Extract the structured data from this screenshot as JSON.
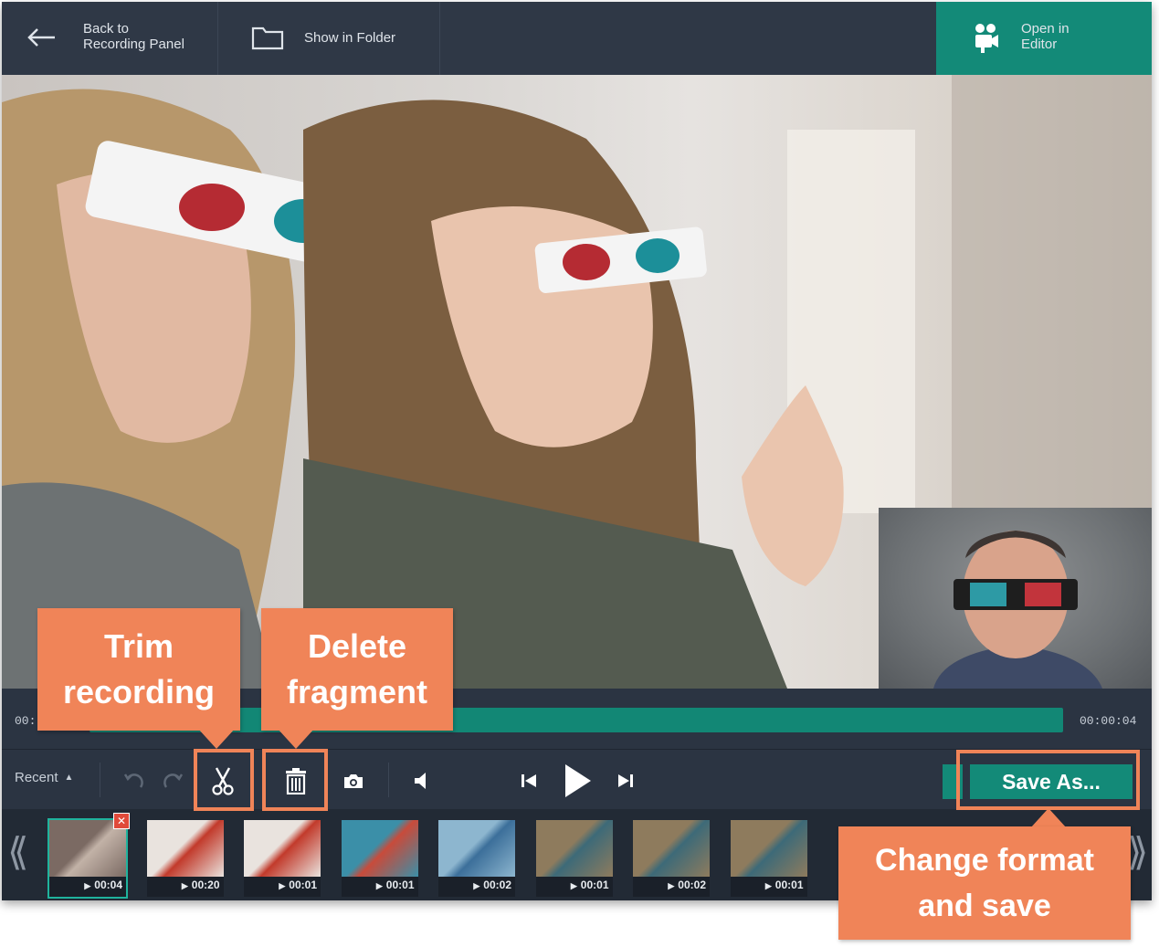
{
  "topbar": {
    "back_label": "Back to\nRecording Panel",
    "folder_label": "Show in Folder",
    "open_label": "Open in\nEditor"
  },
  "timeline": {
    "start_time": "00:",
    "end_time": "00:00:04"
  },
  "controls": {
    "recent_label": "Recent",
    "save_label": "Save As..."
  },
  "filmstrip": {
    "thumbnails": [
      {
        "duration": "00:04",
        "selected": true,
        "colors": [
          "#7b6a63",
          "#c2b2a7"
        ]
      },
      {
        "duration": "00:20",
        "colors": [
          "#e9e3de",
          "#c23a2b"
        ]
      },
      {
        "duration": "00:01",
        "colors": [
          "#e9e3de",
          "#c23a2b"
        ]
      },
      {
        "duration": "00:01",
        "colors": [
          "#3b8fa8",
          "#c84b3b"
        ]
      },
      {
        "duration": "00:02",
        "colors": [
          "#8db6cf",
          "#3c6f9a"
        ]
      },
      {
        "duration": "00:01",
        "colors": [
          "#8e7b5d",
          "#3d6a78"
        ]
      },
      {
        "duration": "00:02",
        "colors": [
          "#8e7b5d",
          "#3d6a78"
        ]
      },
      {
        "duration": "00:01",
        "colors": [
          "#8e7b5d",
          "#3d6a78"
        ]
      }
    ]
  },
  "callouts": {
    "trim": "Trim\nrecording",
    "delete": "Delete\nfragment",
    "save": "Change format\nand save"
  },
  "colors": {
    "accent": "#138a78",
    "annotation": "#f08458",
    "panel": "#2b3442"
  }
}
